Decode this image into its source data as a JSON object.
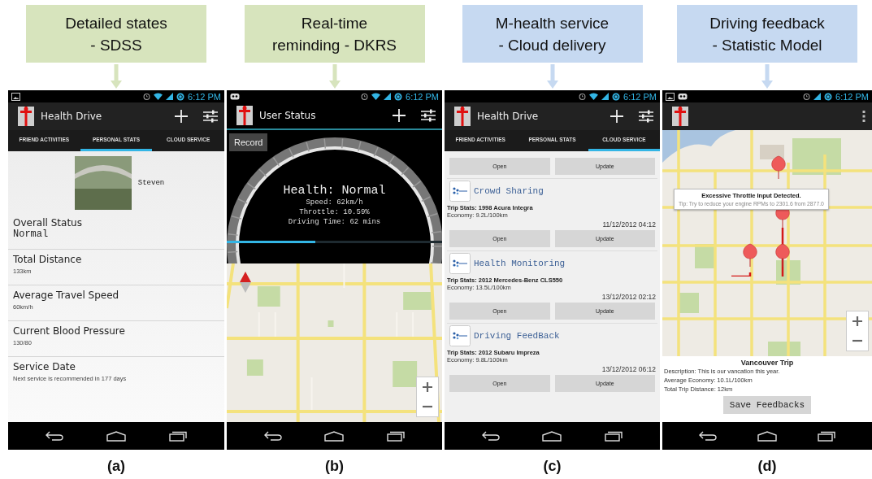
{
  "panels": [
    {
      "kind": "stats",
      "callout": {
        "lines": [
          "Detailed states",
          "- SDSS"
        ],
        "color": "#d7e4bd"
      },
      "caption": "(a)",
      "screen": {
        "time": "6:12 PM",
        "title": "Health Drive",
        "tabs": [
          {
            "label": "FRIEND ACTIVITIES",
            "selected": false
          },
          {
            "label": "PERSONAL STATS",
            "selected": true
          },
          {
            "label": "CLOUD SERVICE",
            "selected": false
          }
        ],
        "profile_name": "Steven",
        "rows": [
          {
            "label": "Overall Status",
            "value": "Normal",
            "kind": "large"
          },
          {
            "label": "Total Distance",
            "value": "133km",
            "kind": "small"
          },
          {
            "label": "Average Travel Speed",
            "value": "60km/h",
            "kind": "small"
          },
          {
            "label": "Current Blood Pressure",
            "value": "130/80",
            "kind": "small"
          },
          {
            "label": "Service Date",
            "value": "Next service is recommended in 177 days",
            "kind": "small"
          }
        ]
      }
    },
    {
      "kind": "gauge",
      "callout": {
        "lines": [
          "Real-time",
          "reminding - DKRS"
        ],
        "color": "#d7e4bd"
      },
      "caption": "(b)",
      "screen": {
        "time": "6:12 PM",
        "title": "User Status",
        "record_button": "Record",
        "health": "Health: Normal",
        "lines": [
          "Speed: 62km/h",
          "Throttle: 10.59%",
          "Driving Time: 62 mins"
        ],
        "progress": {
          "level": 0.41
        }
      }
    },
    {
      "kind": "cloud",
      "callout": {
        "lines": [
          "M-health service",
          "- Cloud delivery"
        ],
        "color": "#c6d9f1"
      },
      "caption": "(c)",
      "screen": {
        "time": "6:12 PM",
        "title": "Health Drive",
        "tabs": [
          {
            "label": "FRIEND ACTIVITIES",
            "selected": false
          },
          {
            "label": "PERSONAL STATS",
            "selected": false
          },
          {
            "label": "CLOUD SERVICE",
            "selected": true
          }
        ],
        "top_buttons": [
          "Open",
          "Update"
        ],
        "cards": [
          {
            "title": "Crowd Sharing",
            "trip": "Trip Stats: 1998 Acura Integra",
            "economy": "Economy: 9.2L/100km",
            "date": "11/12/2012 04:12",
            "buttons": [
              "Open",
              "Update"
            ]
          },
          {
            "title": "Health Monitoring",
            "trip": "Trip Stats: 2012 Mercedes-Benz CLS550",
            "economy": "Economy: 13.5L/100km",
            "date": "13/12/2012 02:12",
            "buttons": [
              "Open",
              "Update"
            ]
          },
          {
            "title": "Driving FeedBack",
            "trip": "Trip Stats: 2012 Subaru Impreza",
            "economy": "Economy: 9.8L/100km",
            "date": "13/12/2012 06:12",
            "buttons": [
              "Open",
              "Update"
            ]
          }
        ]
      }
    },
    {
      "kind": "map",
      "callout": {
        "lines": [
          "Driving feedback",
          "- Statistic Model"
        ],
        "color": "#c6d9f1"
      },
      "caption": "(d)",
      "screen": {
        "time": "6:12 PM",
        "alert": {
          "title": "Excessive Throttle Input Detected.",
          "tip": "Tip: Try to reduce your engine RPMs to 2301.6 from 2877.0"
        },
        "trip_title": "Vancouver Trip",
        "details": [
          "Description: This is our vancation this year.",
          "Average Economy: 10.1L/100km",
          "Total Trip Distance: 12km"
        ],
        "save_button": "Save Feedbacks"
      }
    }
  ]
}
